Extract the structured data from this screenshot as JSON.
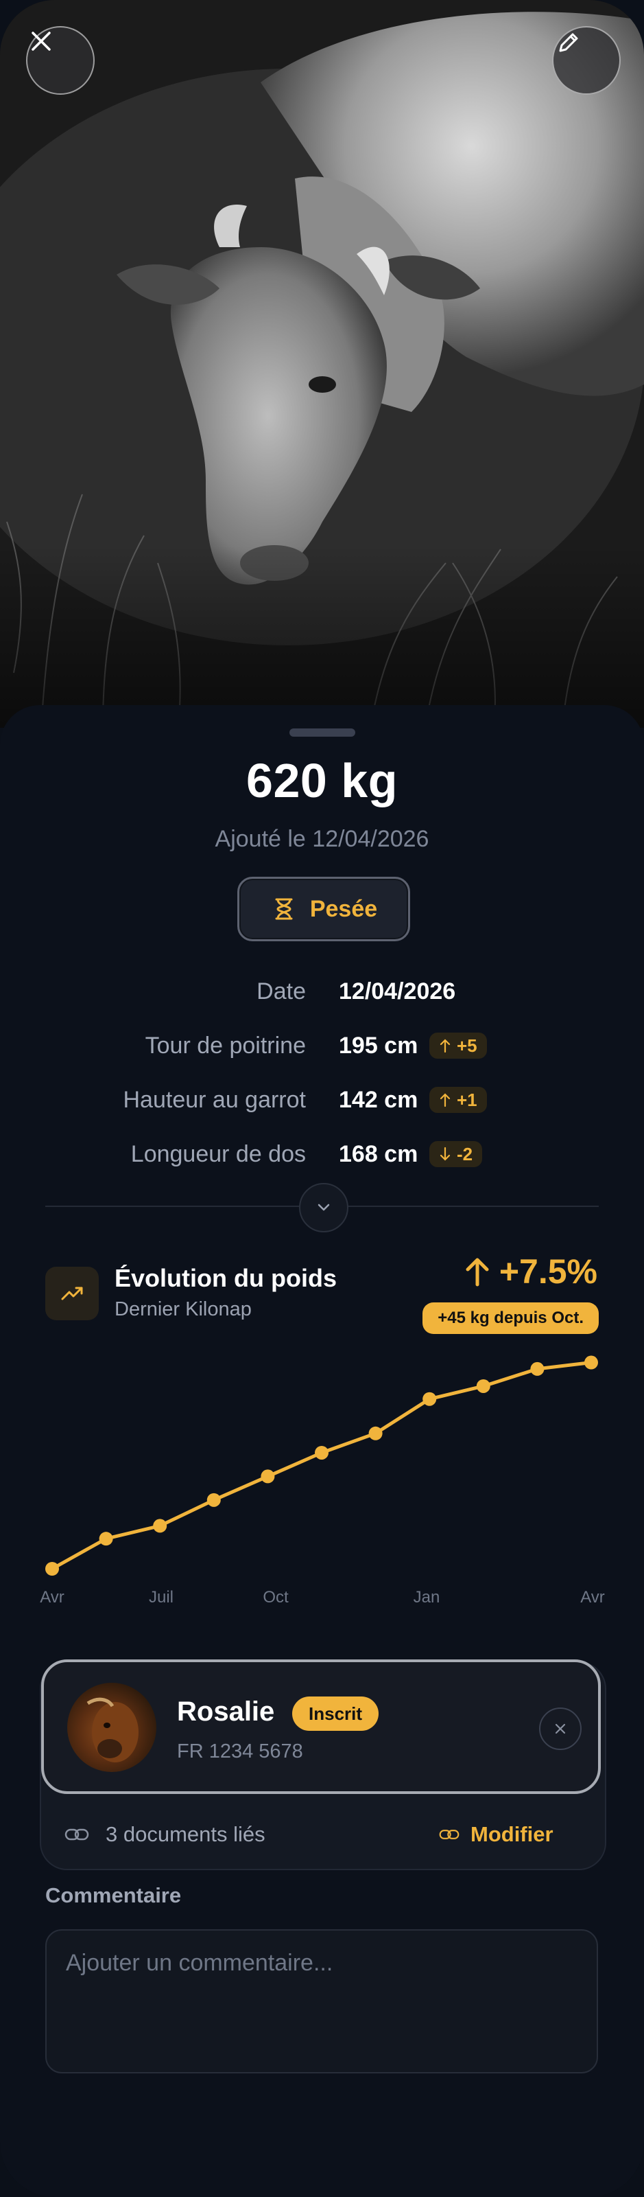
{
  "hero": {
    "image": "grazing-cow-photo",
    "close_icon": "close-icon",
    "edit_icon": "pencil-icon"
  },
  "weighing": {
    "weight": "620 kg",
    "added_text": "Ajouté le 12/04/2026",
    "type_button": {
      "label": "Pesée",
      "icon": "scale-icon"
    }
  },
  "details": [
    {
      "label": "Date",
      "value": "12/04/2026"
    },
    {
      "label": "Tour de poitrine",
      "value": "195 cm",
      "delta": "+5",
      "direction": "up"
    },
    {
      "label": "Hauteur au garrot",
      "value": "142 cm",
      "delta": "+1",
      "direction": "up"
    },
    {
      "label": "Longueur de dos",
      "value": "168 cm",
      "delta": "-2",
      "direction": "down"
    }
  ],
  "evolution": {
    "title": "Évolution du poids",
    "subtitle": "Dernier Kilonap",
    "change": "+7.5%",
    "since_badge": "+45 kg depuis Oct.",
    "icon": "trending-up-icon"
  },
  "chart_data": {
    "type": "line",
    "title": "",
    "x_tick_labels": [
      "Avr",
      "Juil",
      "Oct",
      "Jan",
      "Avr"
    ],
    "points_relative": [
      0.0,
      0.14,
      0.2,
      0.32,
      0.43,
      0.54,
      0.63,
      0.79,
      0.85,
      0.93,
      0.96
    ],
    "line_color": "#f1b43c",
    "grid": false
  },
  "owner": {
    "name": "Rosalie",
    "badge": "Inscrit",
    "id": "FR 1234 5678",
    "avatar": "cow-avatar",
    "remove_icon": "close-icon"
  },
  "documents": {
    "label": "3 documents liés",
    "icon": "link-icon",
    "modify_label": "Modifier"
  },
  "comment": {
    "label": "Commentaire",
    "placeholder": "Ajouter un commentaire..."
  },
  "colors": {
    "accent": "#f1b43c",
    "background": "#0c111b",
    "muted_text": "#a0a7b6"
  }
}
